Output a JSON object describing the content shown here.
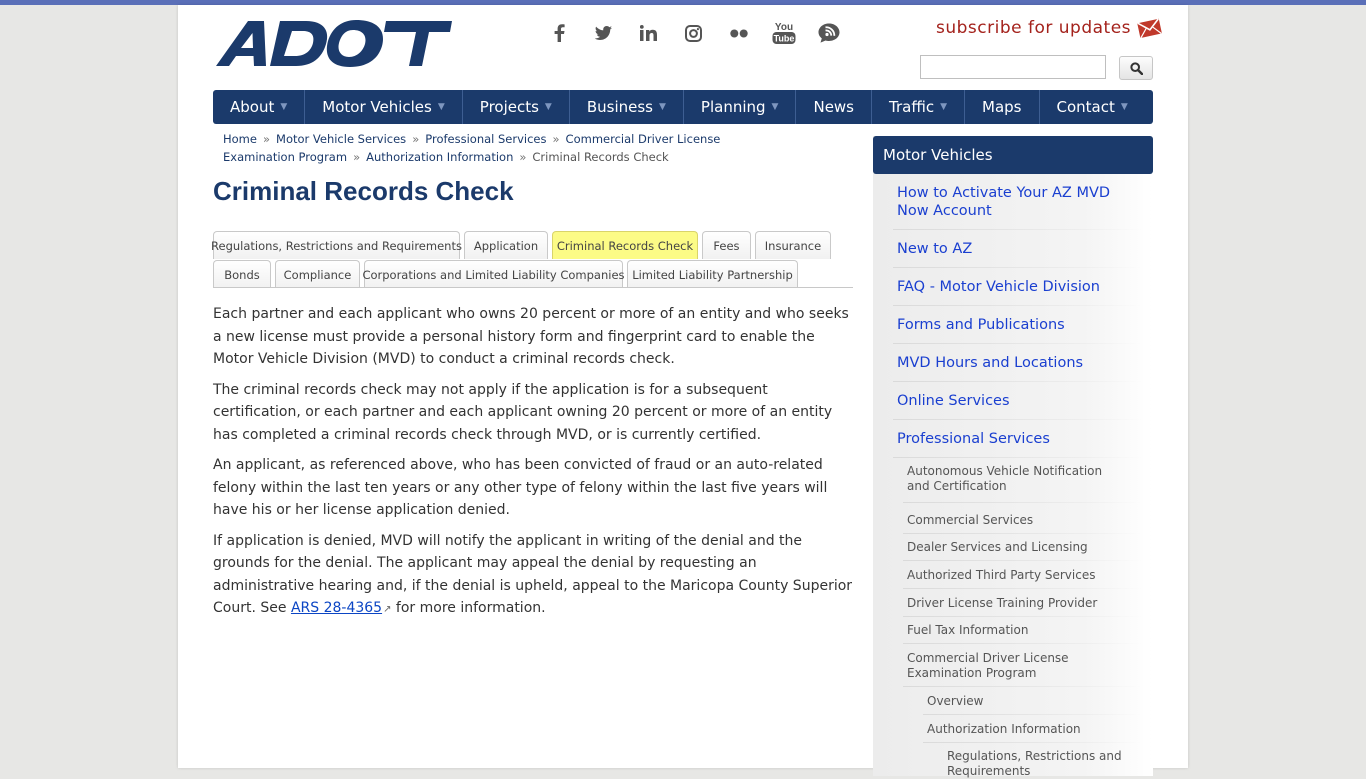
{
  "header": {
    "logo_text": "ADOT",
    "subscribe_label": "subscribe for updates",
    "social": [
      {
        "icon": "facebook-icon"
      },
      {
        "icon": "twitter-icon"
      },
      {
        "icon": "linkedin-icon"
      },
      {
        "icon": "instagram-icon"
      },
      {
        "icon": "flickr-icon"
      },
      {
        "icon": "youtube-icon",
        "label_top": "You",
        "label_bottom": "Tube"
      },
      {
        "icon": "blog-icon"
      }
    ],
    "search": {
      "value": "",
      "placeholder": ""
    }
  },
  "nav": {
    "items": [
      {
        "label": "About",
        "dropdown": true
      },
      {
        "label": "Motor Vehicles",
        "dropdown": true
      },
      {
        "label": "Projects",
        "dropdown": true
      },
      {
        "label": "Business",
        "dropdown": true
      },
      {
        "label": "Planning",
        "dropdown": true
      },
      {
        "label": "News",
        "dropdown": false
      },
      {
        "label": "Traffic",
        "dropdown": true
      },
      {
        "label": "Maps",
        "dropdown": false
      },
      {
        "label": "Contact",
        "dropdown": true
      }
    ]
  },
  "breadcrumb": {
    "items": [
      "Home",
      "Motor Vehicle Services",
      "Professional Services",
      "Commercial Driver License Examination Program",
      "Authorization Information"
    ],
    "current": "Criminal Records Check",
    "separator": "»"
  },
  "page": {
    "title": "Criminal Records Check"
  },
  "tabs": {
    "row1": [
      "Regulations, Restrictions and Requirements",
      "Application",
      "Criminal Records Check",
      "Fees",
      "Insurance"
    ],
    "row2": [
      "Bonds",
      "Compliance",
      "Corporations and Limited Liability Companies",
      "Limited Liability Partnership"
    ],
    "active": "Criminal Records Check"
  },
  "content": {
    "p1": "Each partner and each applicant who owns 20 percent or more of an entity and who seeks a new license must provide a personal history form and fingerprint card to enable the Motor Vehicle Division (MVD) to conduct a criminal records check.",
    "p2": "The criminal records check may not apply if the application is for a subsequent certification, or each partner and each applicant owning 20 percent or more of an entity has completed a criminal records check through MVD, or is currently certified.",
    "p3": "An applicant, as referenced above, who has been convicted of fraud or an auto-related felony within the last ten years or any other type of felony within the last five years will have his or her license application denied.",
    "p4_before": "If application is denied, MVD will notify the applicant in writing of the denial and the grounds for the denial. The applicant may appeal the denial by requesting an administrative hearing and, if the denial is upheld, appeal to the Maricopa County Superior Court. See ",
    "p4_link": "ARS 28-4365",
    "p4_after": " for more information."
  },
  "sidebar": {
    "header": "Motor Vehicles",
    "items": [
      "How to Activate Your AZ MVD Now Account",
      "New to AZ",
      "FAQ - Motor Vehicle Division",
      "Forms and Publications",
      "MVD Hours and Locations",
      "Online Services",
      "Professional Services"
    ],
    "sub_items": [
      "Autonomous Vehicle Notification and Certification",
      "Commercial Services",
      "Dealer Services and Licensing",
      "Authorized Third Party Services",
      "Driver License Training Provider",
      "Fuel Tax Information",
      "Commercial Driver License Examination Program"
    ],
    "sub_sub_items": [
      "Overview",
      "Authorization Information"
    ],
    "sub_sub_sub_items": [
      "Regulations, Restrictions and Requirements"
    ]
  },
  "colors": {
    "brand_navy": "#1b3a6b",
    "subscribe_red": "#a4221c",
    "active_tab": "#fcfb86",
    "link_blue": "#1a3fd0"
  }
}
